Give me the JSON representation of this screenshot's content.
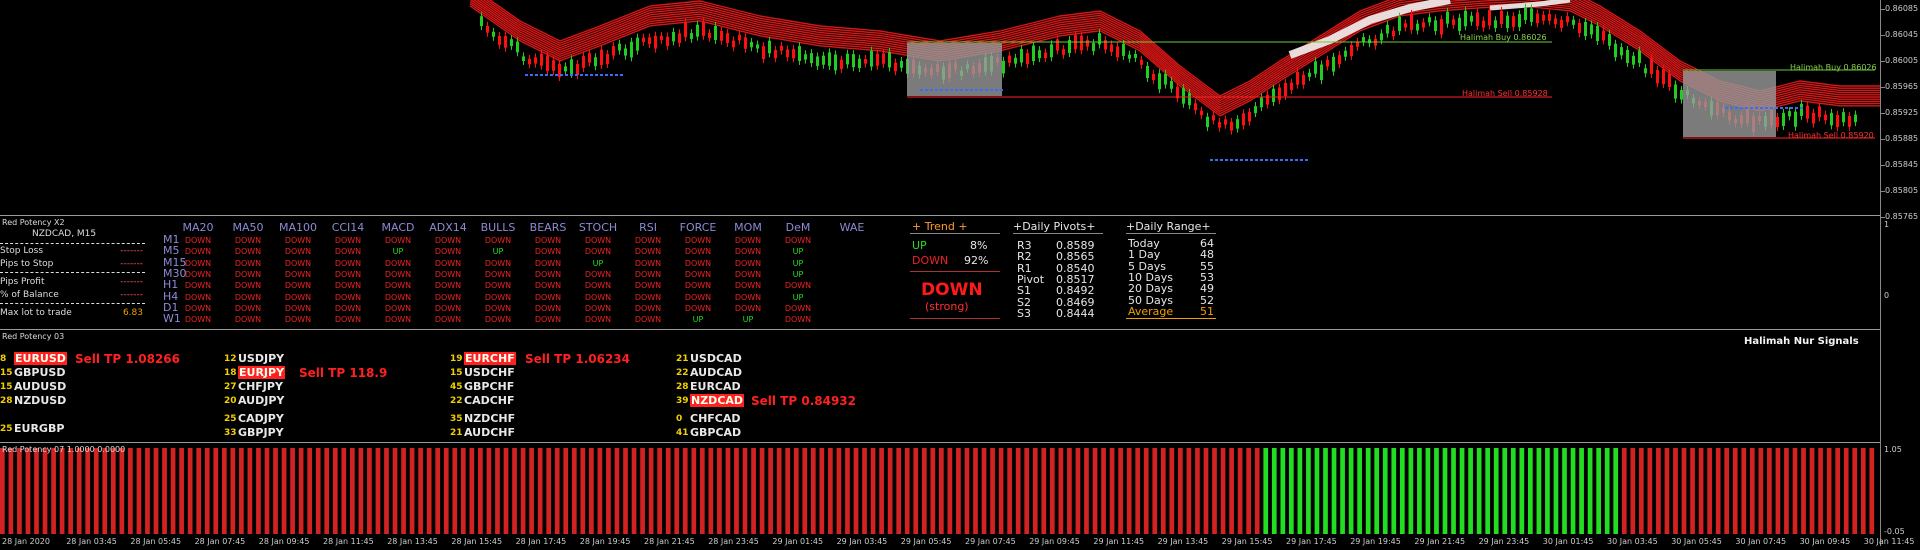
{
  "chart": {
    "price_axis": [
      "0.86085",
      "0.86045",
      "0.86005",
      "0.85965",
      "0.85925",
      "0.85885",
      "0.85845",
      "0.85805",
      "0.85765"
    ],
    "line_labels": {
      "buy_1": "Halimah Buy 0.86026",
      "sell_1": "Halimah Sell 0.85928",
      "buy_2": "Halimah Buy 0.86026",
      "sell_2": "Halimah Sell 0.85920"
    },
    "colors": {
      "bull": "#22cc22",
      "bear": "#ff1010",
      "ribbon": "#ff1a1a",
      "buy_line": "#66cc33",
      "sell_line": "#ff2222",
      "box": "#9a9a9a"
    }
  },
  "potency": {
    "title": "Red Potency X2",
    "symbol": "NZDCAD, M15",
    "left_rows": [
      {
        "label": "Stop Loss",
        "value": "-------"
      },
      {
        "label": "Pips to Stop",
        "value": "-------"
      },
      {
        "label": "Pips Profit",
        "value": "-------"
      },
      {
        "label": "% of Balance",
        "value": "-------"
      },
      {
        "label": "Max lot to trade",
        "value": "6.83"
      }
    ],
    "columns": [
      "MA20",
      "MA50",
      "MA100",
      "CCI14",
      "MACD",
      "ADX14",
      "BULLS",
      "BEARS",
      "STOCH",
      "RSI",
      "FORCE",
      "MOM",
      "DeM",
      "WAE"
    ],
    "timeframes": [
      "M1",
      "M5",
      "M15",
      "M30",
      "H1",
      "H4",
      "D1",
      "W1"
    ],
    "axis": [
      "1",
      "0"
    ],
    "trend": {
      "header": "+  Trend  +",
      "up_label": "UP",
      "up_pct": "8%",
      "down_label": "DOWN",
      "down_pct": "92%",
      "big": "DOWN",
      "strength": "(strong)"
    },
    "pivots": {
      "header": "+Daily Pivots+",
      "rows": [
        {
          "name": "R3",
          "value": "0.8589"
        },
        {
          "name": "R2",
          "value": "0.8565"
        },
        {
          "name": "R1",
          "value": "0.8540"
        },
        {
          "name": "Pivot",
          "value": "0.8517"
        },
        {
          "name": "S1",
          "value": "0.8492"
        },
        {
          "name": "S2",
          "value": "0.8469"
        },
        {
          "name": "S3",
          "value": "0.8444"
        }
      ]
    },
    "range": {
      "header": "+Daily Range+",
      "rows": [
        {
          "name": "Today",
          "value": "64"
        },
        {
          "name": "1 Day",
          "value": "48"
        },
        {
          "name": "5 Days",
          "value": "55"
        },
        {
          "name": "10 Days",
          "value": "53"
        },
        {
          "name": "20 Days",
          "value": "49"
        },
        {
          "name": "50 Days",
          "value": "52"
        },
        {
          "name": "Average",
          "value": "51"
        }
      ]
    }
  },
  "signals": {
    "title": "Red Potency 03",
    "right_title": "Halimah Nur Signals",
    "items": [
      {
        "num": "8",
        "pair": "EURUSD",
        "signal": "Sell TP 1.08266"
      },
      {
        "num": "15",
        "pair": "GBPUSD",
        "signal": ""
      },
      {
        "num": "15",
        "pair": "AUDUSD",
        "signal": ""
      },
      {
        "num": "28",
        "pair": "NZDUSD",
        "signal": ""
      },
      {
        "num": "25",
        "pair": "EURGBP",
        "signal": ""
      },
      {
        "num": "12",
        "pair": "USDJPY",
        "signal": ""
      },
      {
        "num": "18",
        "pair": "EURJPY",
        "signal": "Sell TP 118.9"
      },
      {
        "num": "27",
        "pair": "CHFJPY",
        "signal": ""
      },
      {
        "num": "20",
        "pair": "AUDJPY",
        "signal": ""
      },
      {
        "num": "25",
        "pair": "CADJPY",
        "signal": ""
      },
      {
        "num": "33",
        "pair": "GBPJPY",
        "signal": ""
      },
      {
        "num": "19",
        "pair": "EURCHF",
        "signal": "Sell TP 1.06234"
      },
      {
        "num": "15",
        "pair": "USDCHF",
        "signal": ""
      },
      {
        "num": "45",
        "pair": "GBPCHF",
        "signal": ""
      },
      {
        "num": "22",
        "pair": "CADCHF",
        "signal": ""
      },
      {
        "num": "35",
        "pair": "NZDCHF",
        "signal": ""
      },
      {
        "num": "21",
        "pair": "AUDCHF",
        "signal": ""
      },
      {
        "num": "21",
        "pair": "USDCAD",
        "signal": ""
      },
      {
        "num": "22",
        "pair": "AUDCAD",
        "signal": ""
      },
      {
        "num": "28",
        "pair": "EURCAD",
        "signal": ""
      },
      {
        "num": "39",
        "pair": "NZDCAD",
        "signal": "Sell TP 0.84932"
      },
      {
        "num": "0",
        "pair": "CHFCAD",
        "signal": ""
      },
      {
        "num": "41",
        "pair": "GBPCAD",
        "signal": ""
      }
    ]
  },
  "histogram": {
    "title": "Red Potency 07 1.0000 0.0000",
    "axis": [
      "1.05",
      "-0.05"
    ],
    "bar_count": 220,
    "green_from": 148,
    "green_to": 190,
    "colors": {
      "red": "#d32222",
      "green": "#22dd22"
    }
  },
  "time_axis": [
    "28 Jan 2020",
    "28 Jan 03:45",
    "28 Jan 05:45",
    "28 Jan 07:45",
    "28 Jan 09:45",
    "28 Jan 11:45",
    "28 Jan 13:45",
    "28 Jan 15:45",
    "28 Jan 17:45",
    "28 Jan 19:45",
    "28 Jan 21:45",
    "28 Jan 23:45",
    "29 Jan 01:45",
    "29 Jan 03:45",
    "29 Jan 05:45",
    "29 Jan 07:45",
    "29 Jan 09:45",
    "29 Jan 11:45",
    "29 Jan 13:45",
    "29 Jan 15:45",
    "29 Jan 17:45",
    "29 Jan 19:45",
    "29 Jan 21:45",
    "29 Jan 23:45",
    "30 Jan 01:45",
    "30 Jan 03:45",
    "30 Jan 05:45",
    "30 Jan 07:45",
    "30 Jan 09:45",
    "30 Jan 11:45"
  ]
}
